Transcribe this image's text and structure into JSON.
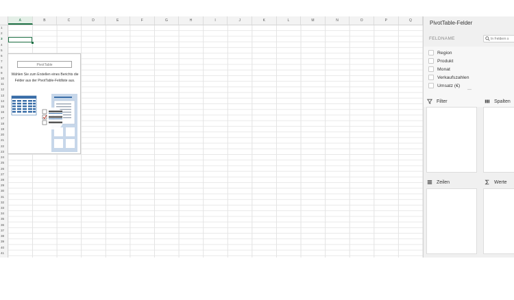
{
  "sheet": {
    "columns": [
      "A",
      "B",
      "C",
      "D",
      "E",
      "F",
      "G",
      "H",
      "I",
      "J",
      "K",
      "L",
      "M",
      "N",
      "O",
      "P",
      "Q"
    ],
    "rows": [
      "1",
      "2",
      "3",
      "4",
      "5",
      "6",
      "7",
      "8",
      "9",
      "10",
      "11",
      "12",
      "13",
      "14",
      "15",
      "16",
      "17",
      "18",
      "19",
      "20",
      "21",
      "22",
      "23",
      "24",
      "25",
      "26",
      "27",
      "28",
      "29",
      "30",
      "31",
      "32",
      "33",
      "34",
      "35",
      "36",
      "37",
      "38",
      "39",
      "40",
      "41"
    ],
    "active_column": "A",
    "active_row": "3"
  },
  "pivot_placeholder": {
    "title": "PivotTable",
    "instructions": "Wählen Sie zum Erstellen eines Berichts die Felder aus der PivotTable-Feldliste aus."
  },
  "field_pane": {
    "title": "PivotTable-Felder",
    "field_name_label": "FELDNAME",
    "search_placeholder": "In Feldern s",
    "fields": [
      {
        "label": "Region",
        "checked": false
      },
      {
        "label": "Produkt",
        "checked": false
      },
      {
        "label": "Monat",
        "checked": false
      },
      {
        "label": "Verkaufszahlen",
        "checked": false
      },
      {
        "label": "Umsatz (€)",
        "checked": false
      }
    ],
    "areas": {
      "filter": {
        "label": "Filter",
        "icon": "filter-icon"
      },
      "columns": {
        "label": "Spalten",
        "icon": "columns-icon"
      },
      "rows": {
        "label": "Zeilen",
        "icon": "rows-icon"
      },
      "values": {
        "label": "Werte",
        "icon": "sigma-icon"
      }
    }
  },
  "colors": {
    "accent": "#1e7145",
    "pane_background": "#f0f0f0",
    "illustration_blue": "#3a6ea8"
  }
}
